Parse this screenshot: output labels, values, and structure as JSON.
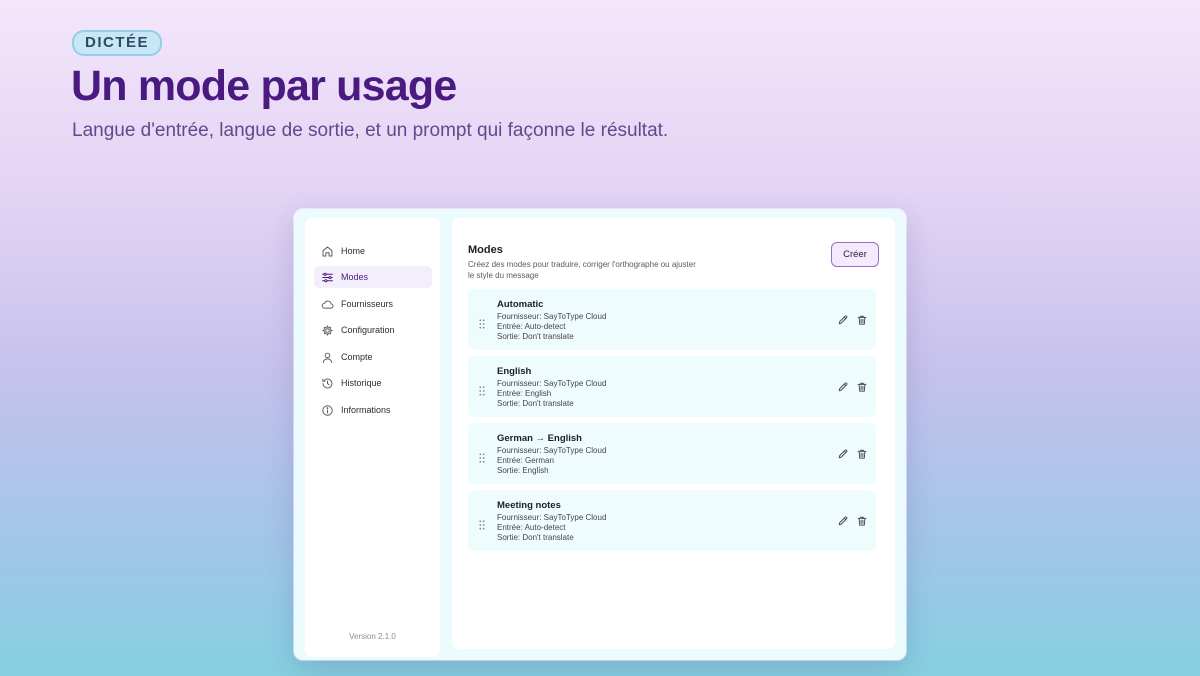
{
  "hero": {
    "badge": "DICTÉE",
    "title": "Un mode par usage",
    "subtitle": "Langue d'entrée, langue de sortie, et un prompt qui façonne le résultat."
  },
  "sidebar": {
    "items": [
      {
        "label": "Home",
        "icon": "home-icon",
        "active": false
      },
      {
        "label": "Modes",
        "icon": "sliders-icon",
        "active": true
      },
      {
        "label": "Fournisseurs",
        "icon": "cloud-icon",
        "active": false
      },
      {
        "label": "Configuration",
        "icon": "gear-icon",
        "active": false
      },
      {
        "label": "Compte",
        "icon": "user-icon",
        "active": false
      },
      {
        "label": "Historique",
        "icon": "history-icon",
        "active": false
      },
      {
        "label": "Informations",
        "icon": "info-icon",
        "active": false
      }
    ],
    "version": "Version 2.1.0"
  },
  "main": {
    "title": "Modes",
    "description": "Créez des modes pour traduire, corriger l'orthographe ou ajuster le style du message",
    "create_label": "Créer",
    "modes": [
      {
        "name": "Automatic",
        "provider": "Fournisseur: SayToType Cloud",
        "input": "Entrée: Auto-detect",
        "output": "Sortie: Don't translate"
      },
      {
        "name": "English",
        "provider": "Fournisseur: SayToType Cloud",
        "input": "Entrée: English",
        "output": "Sortie: Don't translate"
      },
      {
        "name": "German → English",
        "provider": "Fournisseur: SayToType Cloud",
        "input": "Entrée: German",
        "output": "Sortie: English"
      },
      {
        "name": "Meeting notes",
        "provider": "Fournisseur: SayToType Cloud",
        "input": "Entrée: Auto-detect",
        "output": "Sortie: Don't translate"
      }
    ]
  },
  "colors": {
    "accent": "#4a1a80",
    "card_bg": "#effcfd",
    "active_nav_bg": "#f3eefb",
    "button_border": "#9a6fc8"
  }
}
